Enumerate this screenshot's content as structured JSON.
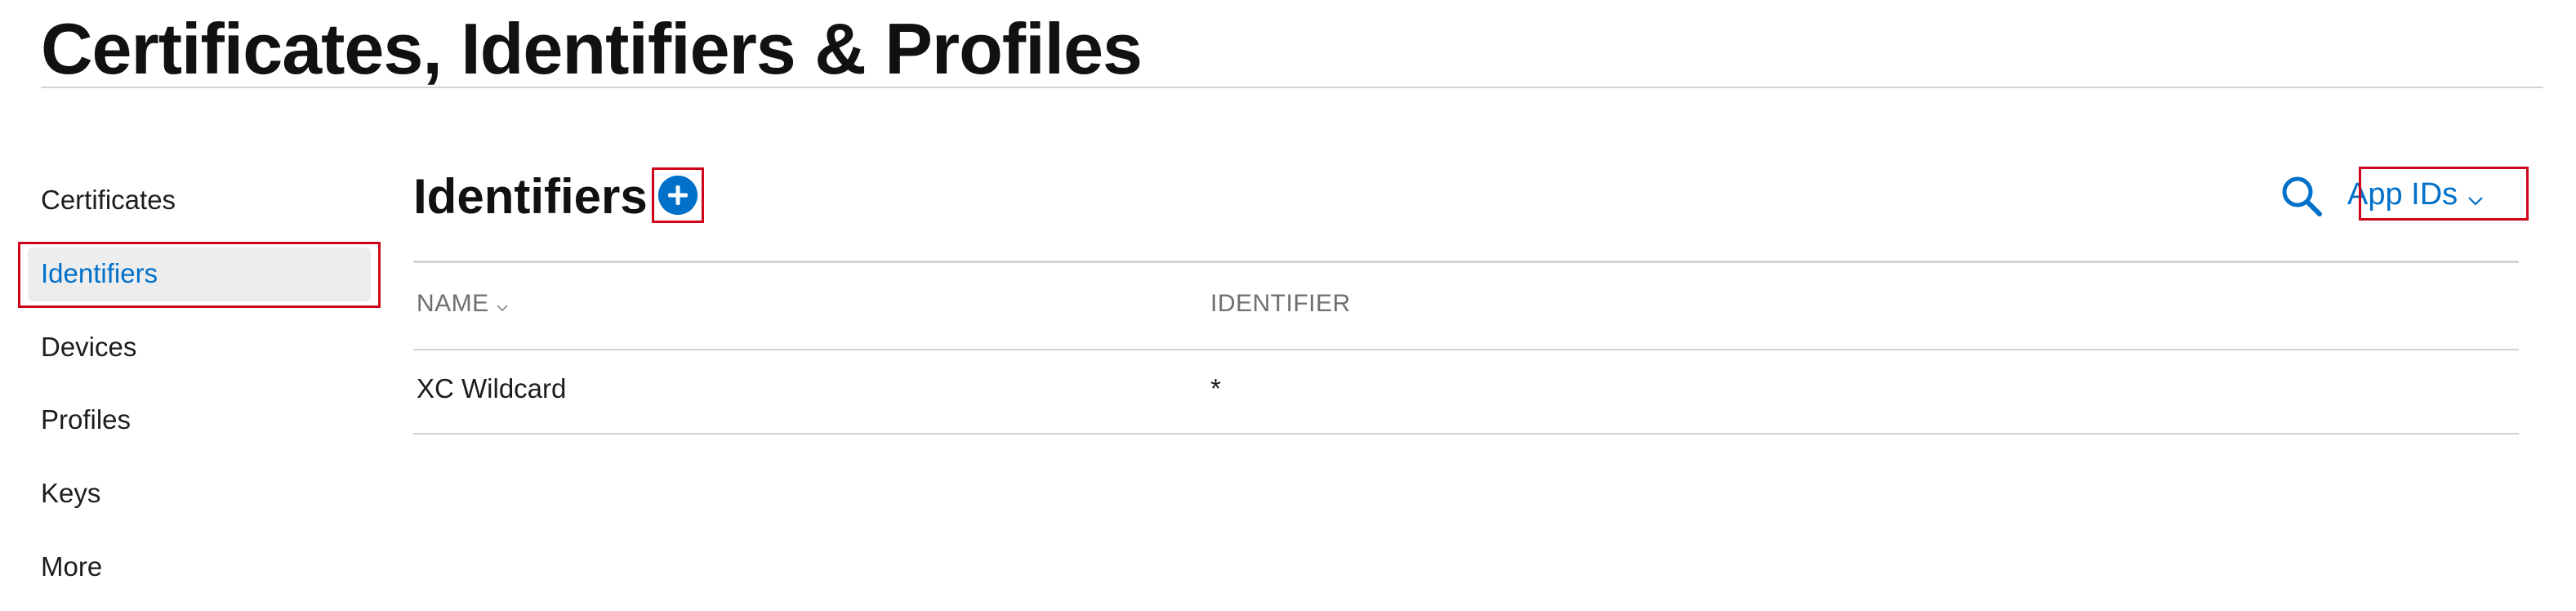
{
  "header": {
    "title": "Certificates, Identifiers & Profiles"
  },
  "sidebar": {
    "items": [
      {
        "label": "Certificates",
        "active": false
      },
      {
        "label": "Identifiers",
        "active": true
      },
      {
        "label": "Devices",
        "active": false
      },
      {
        "label": "Profiles",
        "active": false
      },
      {
        "label": "Keys",
        "active": false
      },
      {
        "label": "More",
        "active": false
      }
    ]
  },
  "main": {
    "section_title": "Identifiers",
    "add_button_icon": "plus-circle-icon",
    "search_icon": "search-icon",
    "filter": {
      "selected": "App IDs",
      "icon": "chevron-down-icon"
    },
    "table": {
      "columns": [
        {
          "label": "NAME",
          "sortable": true
        },
        {
          "label": "IDENTIFIER",
          "sortable": false
        }
      ],
      "rows": [
        {
          "name": "XC Wildcard",
          "identifier": "*"
        }
      ]
    }
  },
  "colors": {
    "accent": "#0070c9",
    "highlight": "#d0021b",
    "active_bg": "#ededed",
    "divider": "#d2d2d7"
  }
}
